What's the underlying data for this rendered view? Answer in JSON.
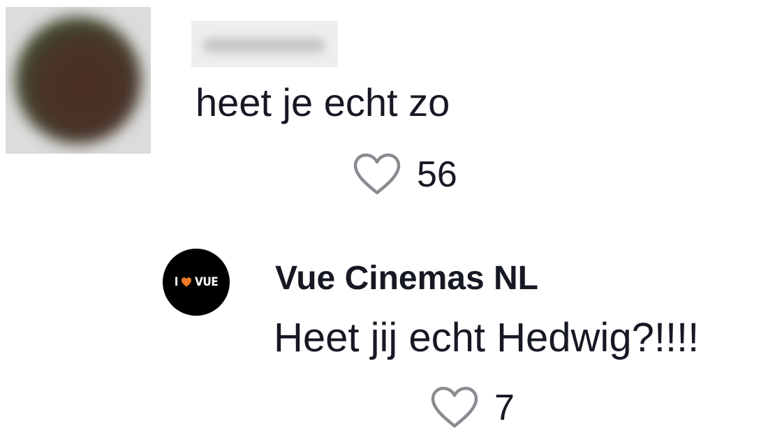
{
  "top_comment": {
    "avatar_icon": "blurred-avatar",
    "username": "",
    "text": "heet je echt zo",
    "like_icon": "heart-outline-icon",
    "likes": "56"
  },
  "reply": {
    "avatar_logo": {
      "text": "I ❤ VUE",
      "heart_color": "#f07a28"
    },
    "author": "Vue Cinemas NL",
    "text": "Heet jij echt Hedwig?!!!!",
    "like_icon": "heart-outline-icon",
    "likes": "7"
  },
  "colors": {
    "text": "#161823",
    "icon_stroke": "#8a8b91",
    "background": "#ffffff"
  }
}
